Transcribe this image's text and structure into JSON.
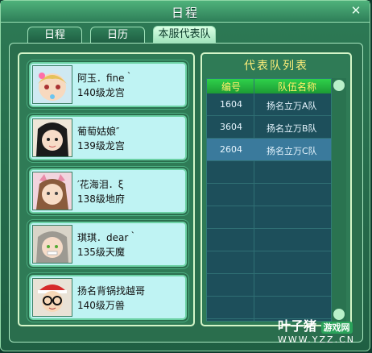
{
  "window": {
    "title": "日程"
  },
  "tabs": [
    {
      "label": "日程"
    },
    {
      "label": "日历"
    },
    {
      "label": "本服代表队"
    }
  ],
  "members": [
    {
      "name": "阿玉．fine｀",
      "info": "140级龙宫"
    },
    {
      "name": "葡萄姑娘″",
      "info": "139级龙宫"
    },
    {
      "name": "′花海泪．ξ",
      "info": "138级地府"
    },
    {
      "name": "琪琪．dear｀",
      "info": "135级天魔"
    },
    {
      "name": "扬名背锅找越哥",
      "info": "140级万兽"
    }
  ],
  "team_list": {
    "title": "代表队列表",
    "columns": [
      "编号",
      "队伍名称"
    ],
    "rows": [
      {
        "id": "1604",
        "name": "扬名立万A队"
      },
      {
        "id": "3604",
        "name": "扬名立万B队"
      },
      {
        "id": "2604",
        "name": "扬名立万C队"
      }
    ],
    "selected": "2604"
  },
  "watermark": {
    "main": "叶子猪",
    "badge": "游戏网",
    "url": "WWW.YZZ.CN"
  }
}
